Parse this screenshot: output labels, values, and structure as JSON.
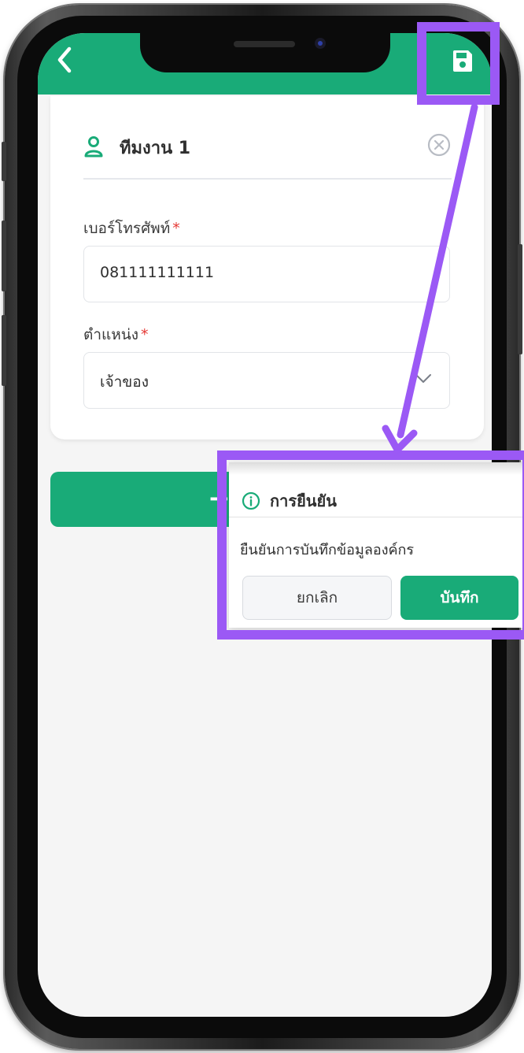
{
  "header": {
    "back_icon": "chevron-left-icon",
    "save_icon": "floppy-disk-icon",
    "color": "#19ab78"
  },
  "team_card": {
    "icon": "person-icon",
    "title": "ทีมงาน 1",
    "remove_icon": "circle-x-icon",
    "phone_label": "เบอร์โทรศัพท์",
    "phone_required": "*",
    "phone_value": "081111111111",
    "position_label": "ตำแหน่ง",
    "position_required": "*",
    "position_value": "เจ้าของ",
    "position_dropdown_icon": "chevron-down-icon"
  },
  "add_button": {
    "label": "+"
  },
  "dialog": {
    "icon": "info-icon",
    "title": "การยืนยัน",
    "message": "ยืนยันการบันทึกข้อมูลองค์กร",
    "cancel_label": "ยกเลิก",
    "confirm_label": "บันทึก"
  },
  "annotation": {
    "color": "#9b59f5"
  }
}
